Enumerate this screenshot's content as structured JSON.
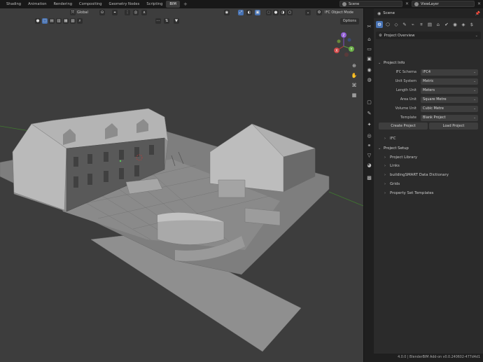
{
  "topbar": {
    "tabs": [
      {
        "label": "Shading",
        "active": false
      },
      {
        "label": "Animation",
        "active": false
      },
      {
        "label": "Rendering",
        "active": false
      },
      {
        "label": "Compositing",
        "active": false
      },
      {
        "label": "Geometry Nodes",
        "active": false
      },
      {
        "label": "Scripting",
        "active": false
      },
      {
        "label": "BIM",
        "active": true
      }
    ],
    "add_tab": "+",
    "scene": "Scene",
    "view_layer": "ViewLayer"
  },
  "viewport": {
    "transform_orientation": "Global",
    "mode": "IFC Object Mode",
    "options_label": "Options"
  },
  "properties": {
    "header_title": "Scene",
    "overview_dropdown": "Project Overview",
    "project_info": {
      "title": "Project Info",
      "fields": [
        {
          "label": "IFC Schema",
          "value": "IFC4"
        },
        {
          "label": "Unit System",
          "value": "Metric"
        },
        {
          "label": "Length Unit",
          "value": "Meters"
        },
        {
          "label": "Area Unit",
          "value": "Square Metre"
        },
        {
          "label": "Volume Unit",
          "value": "Cubic Metre"
        },
        {
          "label": "Template",
          "value": "Blank Project"
        }
      ],
      "create_button": "Create Project",
      "load_button": "Load Project",
      "ifc_section": "IFC"
    },
    "project_setup": {
      "title": "Project Setup",
      "items": [
        "Project Library",
        "Links",
        "buildingSMART Data Dictionary",
        "Grids",
        "Property Set Templates"
      ]
    }
  },
  "status": {
    "version": "4.0.0",
    "addon": "BlenderBIM Add-on v0.0.240602-477d4d1"
  },
  "colors": {
    "accent": "#4772b3",
    "viewport_bg": "#3d3d3d",
    "panel_bg": "#2b2b2b"
  }
}
